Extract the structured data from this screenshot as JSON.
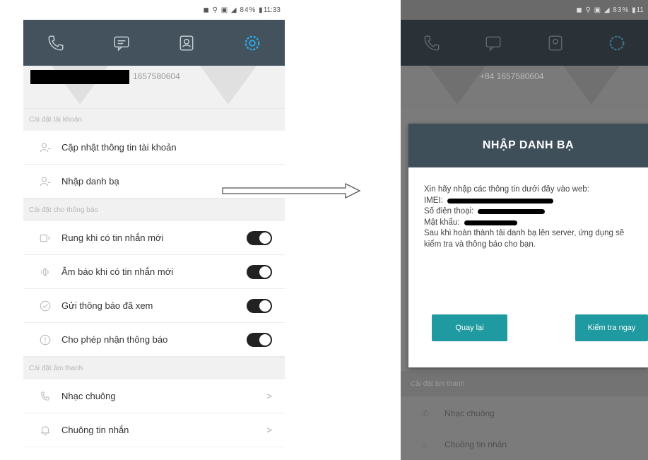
{
  "left_screen": {
    "status": {
      "text": "11:33"
    },
    "tabs": [
      {
        "name": "phone-icon"
      },
      {
        "name": "message-icon"
      },
      {
        "name": "contacts-icon"
      },
      {
        "name": "settings-icon"
      }
    ],
    "profile": {
      "phone_number": "1657580604"
    },
    "section_account": "Cài đặt tài khoản",
    "account_items": [
      {
        "label": "Cập nhật thông tin tài khoản",
        "icon": "user-icon"
      },
      {
        "label": "Nhập danh bạ",
        "icon": "user-icon"
      }
    ],
    "section_notify": "Cài đặt cho thông báo",
    "notify_items": [
      {
        "label": "Rung khi có tin nhắn mới",
        "icon": "vibrate-icon",
        "on": true
      },
      {
        "label": "Âm báo khi có tin nhắn mới",
        "icon": "sound-icon",
        "on": true
      },
      {
        "label": "Gửi thông báo đã xem",
        "icon": "check-circle-icon",
        "on": true
      },
      {
        "label": "Cho phép nhận thông báo",
        "icon": "info-icon",
        "on": true
      }
    ],
    "section_sound": "Cài đặt âm thanh",
    "sound_items": [
      {
        "label": "Nhạc chuông",
        "icon": "ringtone-icon",
        "chevron": ">"
      },
      {
        "label": "Chuông tin nhắn",
        "icon": "bell-icon",
        "chevron": ">"
      }
    ]
  },
  "right_screen": {
    "status": {
      "text": "11"
    },
    "profile": {
      "phone_number": "+84 1657580604"
    },
    "dialog": {
      "title": "NHẬP DANH BẠ",
      "intro": "Xin hãy nhập các thông tin dưới đây vào web:",
      "imei_label": "IMEI:",
      "phone_label": "Số điện thoại:",
      "password_label": "Mật khẩu:",
      "outro": "Sau khi hoàn thành tải danh bạ lên server, ứng dụng sẽ kiểm tra và thông báo cho bạn.",
      "back_button": "Quay lại",
      "check_button": "Kiểm tra ngay"
    },
    "section_sound": "Cài đặt âm thanh",
    "sound_items": [
      {
        "label": "Nhạc chuông"
      },
      {
        "label": "Chuông tin nhắn"
      }
    ]
  },
  "colors": {
    "toolbar": "#43525d",
    "accent": "#1e9aa0",
    "toggle_on": "#222222"
  }
}
